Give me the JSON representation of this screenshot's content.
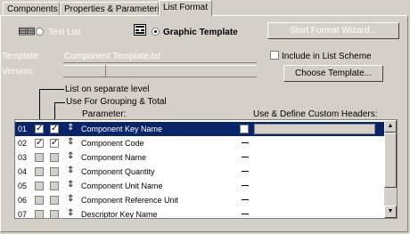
{
  "tabs": [
    {
      "label": "Components"
    },
    {
      "label": "Properties & Parameters"
    },
    {
      "label": "List Format"
    }
  ],
  "mode": {
    "text_list_label": "Text List",
    "graphic_template_label": "Graphic Template",
    "selected": "graphic_template"
  },
  "start_wizard_label": "Start Format Wizard...",
  "template": {
    "label": "Template:",
    "value": "Component Template.txt"
  },
  "version": {
    "label": "Version:",
    "value": ""
  },
  "include_in_list_scheme_label": "Include in List Scheme",
  "choose_template_label": "Choose Template...",
  "columns": {
    "list_on_separate_level": "List on separate level",
    "use_for_grouping": "Use For Grouping & Total",
    "parameter": "Parameter:",
    "use_define_headers": "Use & Define Custom Headers:"
  },
  "rows": [
    {
      "num": "01",
      "name": "Component Key Name",
      "selected": true
    },
    {
      "num": "02",
      "name": "Component Code"
    },
    {
      "num": "03",
      "name": "Component Name"
    },
    {
      "num": "04",
      "name": "Component Quantity"
    },
    {
      "num": "05",
      "name": "Component Unit Name"
    },
    {
      "num": "06",
      "name": "Component Reference Unit"
    },
    {
      "num": "07",
      "name": "Descriptor Key Name"
    }
  ]
}
